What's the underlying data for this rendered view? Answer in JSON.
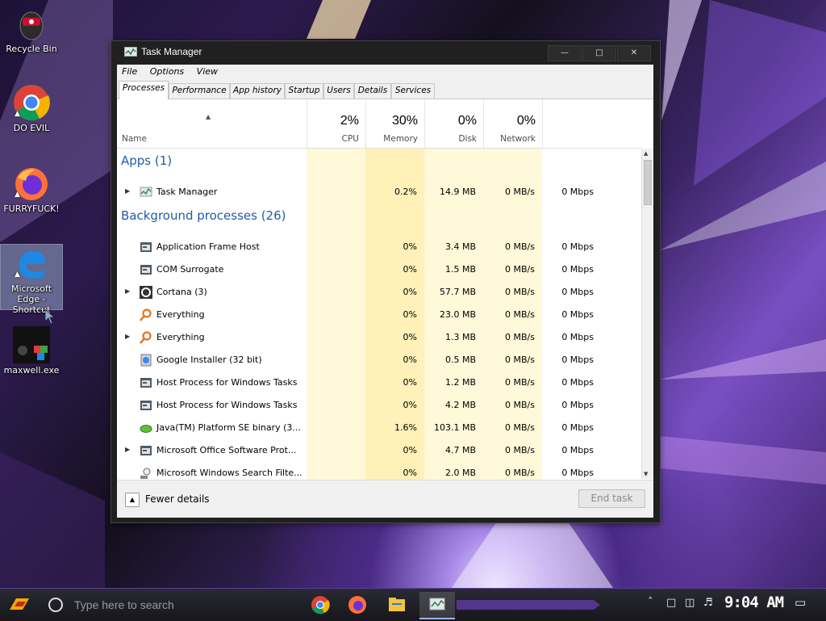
{
  "desktop": {
    "icons": [
      {
        "label": "Recycle Bin"
      },
      {
        "label": "DO EVIL"
      },
      {
        "label": "FURRYFUCK!"
      },
      {
        "label": "Microsoft Edge - Shortcut"
      },
      {
        "label": "maxwell.exe"
      }
    ]
  },
  "window": {
    "title": "Task Manager",
    "controls": {
      "minimize": "—",
      "maximize": "□",
      "close": "✕"
    }
  },
  "menu": [
    "File",
    "Options",
    "View"
  ],
  "tabs": [
    "Processes",
    "Performance",
    "App history",
    "Startup",
    "Users",
    "Details",
    "Services"
  ],
  "columns": {
    "name": "Name",
    "cpu": {
      "pct": "2%",
      "label": "CPU"
    },
    "memory": {
      "pct": "30%",
      "label": "Memory"
    },
    "disk": {
      "pct": "0%",
      "label": "Disk"
    },
    "network": {
      "pct": "0%",
      "label": "Network"
    }
  },
  "groups": {
    "apps": "Apps (1)",
    "background": "Background processes (26)"
  },
  "apps": [
    {
      "name": "Task Manager",
      "cpu": "0.2%",
      "memory": "14.9 MB",
      "disk": "0 MB/s",
      "network": "0 Mbps",
      "expandable": true,
      "icon": "task-manager-icon"
    }
  ],
  "processes": [
    {
      "name": "Application Frame Host",
      "cpu": "0%",
      "memory": "3.4 MB",
      "disk": "0 MB/s",
      "network": "0 Mbps",
      "expandable": false,
      "icon": "process-icon"
    },
    {
      "name": "COM Surrogate",
      "cpu": "0%",
      "memory": "1.5 MB",
      "disk": "0 MB/s",
      "network": "0 Mbps",
      "expandable": false,
      "icon": "process-icon"
    },
    {
      "name": "Cortana (3)",
      "cpu": "0%",
      "memory": "57.7 MB",
      "disk": "0 MB/s",
      "network": "0 Mbps",
      "expandable": true,
      "icon": "cortana-icon"
    },
    {
      "name": "Everything",
      "cpu": "0%",
      "memory": "23.0 MB",
      "disk": "0 MB/s",
      "network": "0 Mbps",
      "expandable": false,
      "icon": "everything-icon"
    },
    {
      "name": "Everything",
      "cpu": "0%",
      "memory": "1.3 MB",
      "disk": "0 MB/s",
      "network": "0 Mbps",
      "expandable": true,
      "icon": "everything-icon"
    },
    {
      "name": "Google Installer (32 bit)",
      "cpu": "0%",
      "memory": "0.5 MB",
      "disk": "0 MB/s",
      "network": "0 Mbps",
      "expandable": false,
      "icon": "installer-icon"
    },
    {
      "name": "Host Process for Windows Tasks",
      "cpu": "0%",
      "memory": "1.2 MB",
      "disk": "0 MB/s",
      "network": "0 Mbps",
      "expandable": false,
      "icon": "process-icon"
    },
    {
      "name": "Host Process for Windows Tasks",
      "cpu": "0%",
      "memory": "4.2 MB",
      "disk": "0 MB/s",
      "network": "0 Mbps",
      "expandable": false,
      "icon": "process-icon"
    },
    {
      "name": "Java(TM) Platform SE binary (3...",
      "cpu": "1.6%",
      "memory": "103.1 MB",
      "disk": "0 MB/s",
      "network": "0 Mbps",
      "expandable": false,
      "icon": "java-icon"
    },
    {
      "name": "Microsoft Office Software Prot...",
      "cpu": "0%",
      "memory": "4.7 MB",
      "disk": "0 MB/s",
      "network": "0 Mbps",
      "expandable": true,
      "icon": "process-icon"
    },
    {
      "name": "Microsoft Windows Search Filte...",
      "cpu": "0%",
      "memory": "2.0 MB",
      "disk": "0 MB/s",
      "network": "0 Mbps",
      "expandable": false,
      "icon": "search-filter-icon"
    }
  ],
  "footer": {
    "fewer_details": "Fewer details",
    "end_task": "End task"
  },
  "taskbar": {
    "search_placeholder": "Type here to search",
    "clock": "9:04 AM",
    "pinned": [
      "chrome-icon",
      "firefox-icon",
      "file-explorer-icon",
      "task-manager-icon"
    ]
  },
  "colors": {
    "group_blue": "#1f5ca8",
    "cpu_heat": "#fff4c6",
    "mem_heat": "#ffeeaa",
    "accent_purple": "#7a4fc4"
  }
}
